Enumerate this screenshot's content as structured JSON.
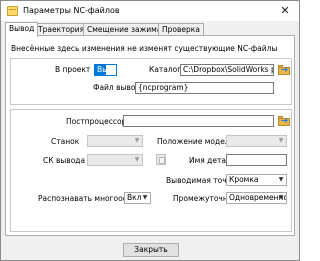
{
  "window": {
    "title": "Параметры NC-файлов",
    "close_glyph": "✕"
  },
  "tabs": [
    {
      "label": "Вывод"
    },
    {
      "label": "Траектория"
    },
    {
      "label": "Смещение зажима"
    },
    {
      "label": "Проверка"
    }
  ],
  "info_text": "Внесённые здесь изменения не изменят существующие NC-файлы",
  "output": {
    "to_project_label": "В проект",
    "to_project_value": "Вык",
    "catalog_label": "Каталог",
    "catalog_value": "C:\\Dropbox\\SolidWorks project",
    "file_name_label": "Файл вывода",
    "file_name_value": "{ncprogram}"
  },
  "settings": {
    "postprocessor_label": "Постпроцессор",
    "postprocessor_value": "",
    "machine_label": "Станок",
    "machine_value": "",
    "model_position_label": "Положение модели",
    "model_position_value": "",
    "output_cs_label": "СК вывода",
    "output_cs_value": "",
    "part_name_label": "Имя детали",
    "part_name_value": "",
    "output_point_label": "Выводимая точка",
    "output_point_value": "Кромка",
    "multiaxis_label": "Распознавать многоосевую",
    "multiaxis_value": "Вкл",
    "intermediate_label": "Промежуточные",
    "intermediate_value": "Одновременно"
  },
  "footer": {
    "close_label": "Закрыть"
  },
  "colors": {
    "accent": "#0078d7",
    "folder": "#e8b74a"
  }
}
